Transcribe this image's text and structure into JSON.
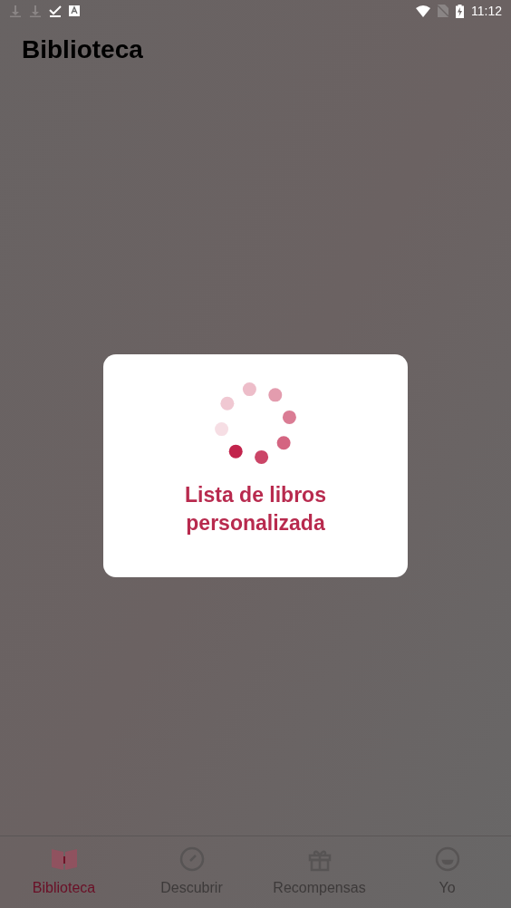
{
  "status_bar": {
    "time": "11:12"
  },
  "header": {
    "title": "Biblioteca"
  },
  "loading_dialog": {
    "message": "Lista de libros personalizada"
  },
  "bottom_nav": [
    {
      "kind": "book",
      "label": "Biblioteca",
      "selected": true
    },
    {
      "kind": "compass",
      "label": "Descubrir",
      "selected": false
    },
    {
      "kind": "gift",
      "label": "Recompensas",
      "selected": false
    },
    {
      "kind": "face",
      "label": "Yo",
      "selected": false
    }
  ]
}
